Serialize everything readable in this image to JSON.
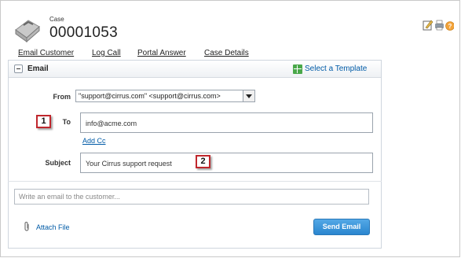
{
  "header": {
    "case_label": "Case",
    "case_number": "00001053",
    "tabs": [
      "Email Customer",
      "Log Call",
      "Portal Answer",
      "Case Details"
    ]
  },
  "email_panel": {
    "title": "Email",
    "select_template": "Select a Template",
    "from_label": "From",
    "from_value": "\"support@cirrus.com\" <support@cirrus.com>",
    "to_label": "To",
    "to_value": "info@acme.com",
    "add_cc": "Add Cc",
    "subject_label": "Subject",
    "subject_value": "Your Cirrus support request",
    "body_placeholder": "Write an email to the customer...",
    "attach_file": "Attach File",
    "send_button": "Send Email"
  },
  "callouts": [
    "1",
    "2"
  ],
  "colors": {
    "link": "#015ba7",
    "send_button": "#2a86cf",
    "callout_border": "#c0272d"
  }
}
